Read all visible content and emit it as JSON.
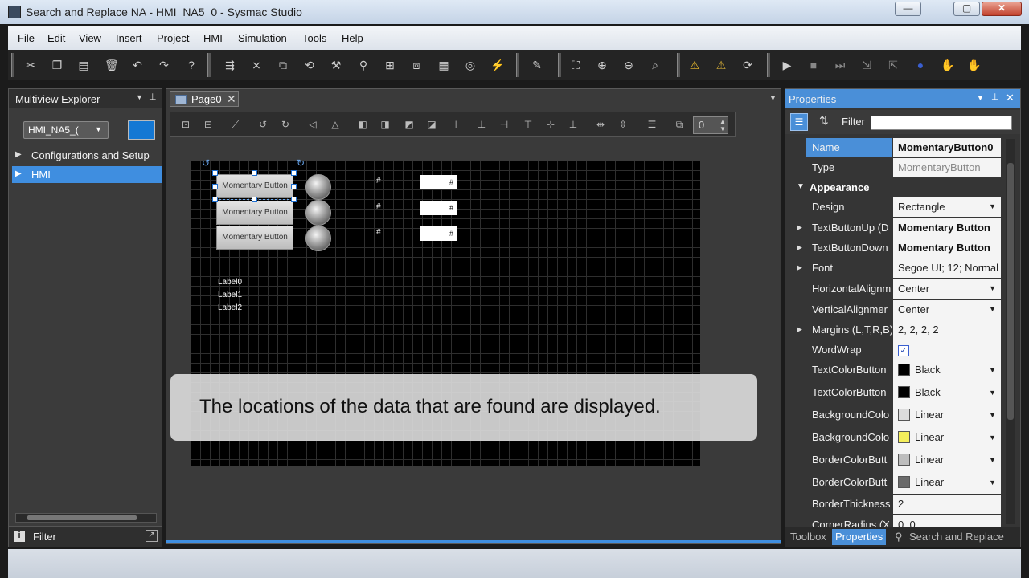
{
  "window": {
    "title": "Search and Replace NA - HMI_NA5_0 - Sysmac Studio",
    "min_glyph": "—",
    "max_glyph": "▢",
    "close_glyph": "✕"
  },
  "menu": [
    "File",
    "Edit",
    "View",
    "Insert",
    "Project",
    "HMI",
    "Simulation",
    "Tools",
    "Help"
  ],
  "toolbar_icons": [
    "cut-icon",
    "copy-icon",
    "paste-icon",
    "delete-icon",
    "undo-icon",
    "redo-icon",
    "help-icon",
    "build-icon",
    "compare-icon",
    "transfer-icon",
    "synchronize-icon",
    "online-icon",
    "search-icon",
    "io-map-icon",
    "cam-icon",
    "table-icon",
    "watch-icon",
    "trace-icon",
    "edit-icon",
    "zoom-fit-icon",
    "zoom-in-icon",
    "zoom-out-icon",
    "zoom-icon",
    "warning-icon",
    "clear-warning-icon",
    "reset-icon",
    "run-icon",
    "stop-icon",
    "step-icon",
    "step-in-icon",
    "step-out-icon",
    "breakpoint-icon",
    "hand-icon",
    "hand-stop-icon"
  ],
  "explorer": {
    "title": "Multiview Explorer",
    "device_dropdown": "HMI_NA5_(",
    "tree": [
      {
        "label": "Configurations and Setup",
        "selected": false
      },
      {
        "label": "HMI",
        "selected": true
      }
    ],
    "filter_label": "Filter"
  },
  "editor": {
    "tab_label": "Page0",
    "tab_close": "✕",
    "zoom_value": "0",
    "buttons": [
      "Momentary Button",
      "Momentary Button",
      "Momentary Button"
    ],
    "hash_marks": [
      "#",
      "#",
      "#"
    ],
    "numeric_boxes": [
      "#",
      "#",
      "#"
    ],
    "labels": [
      "Label0",
      "Label1",
      "Label2"
    ]
  },
  "caption": "The locations of the data that are found are displayed.",
  "properties": {
    "title": "Properties",
    "filter_label": "Filter",
    "filter_value": "",
    "category": "Appearance",
    "rows": [
      {
        "name": "Name",
        "value": "MomentaryButton0"
      },
      {
        "name": "Type",
        "value": "MomentaryButton"
      },
      {
        "name": "Design",
        "value": "Rectangle"
      },
      {
        "name": "TextButtonUp (D",
        "value": "Momentary Button"
      },
      {
        "name": "TextButtonDown",
        "value": "Momentary Button"
      },
      {
        "name": "Font",
        "value": "Segoe UI; 12; Normal"
      },
      {
        "name": "HorizontalAlignm",
        "value": "Center"
      },
      {
        "name": "VerticalAlignmer",
        "value": "Center"
      },
      {
        "name": "Margins (L,T,R,B)",
        "value": "2, 2, 2, 2"
      },
      {
        "name": "WordWrap",
        "value": "✓"
      },
      {
        "name": "TextColorButton",
        "value": "Black"
      },
      {
        "name": "TextColorButton",
        "value": "Black"
      },
      {
        "name": "BackgroundColo",
        "value": "Linear"
      },
      {
        "name": "BackgroundColo",
        "value": "Linear"
      },
      {
        "name": "BorderColorButt",
        "value": "Linear"
      },
      {
        "name": "BorderColorButt",
        "value": "Linear"
      },
      {
        "name": "BorderThickness",
        "value": "2"
      },
      {
        "name": "CornerRadius (X",
        "value": "0, 0"
      }
    ],
    "swatch_colors": {
      "textcolor1": "#000000",
      "textcolor2": "#000000",
      "bg1": "#dcdcdc",
      "bg2": "#f5ef5c",
      "border1": "#bdbdbd",
      "border2": "#6a6a6a"
    },
    "bottom_tabs": [
      "Toolbox",
      "Properties",
      "Search and Replace"
    ]
  },
  "colors": {
    "accent": "#3f8ee0",
    "panel_header_blue": "#4a8fd8"
  }
}
